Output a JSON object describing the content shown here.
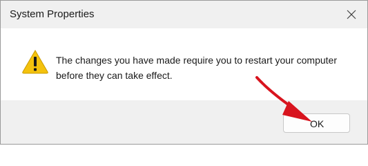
{
  "window": {
    "title": "System Properties"
  },
  "dialog": {
    "message_line1": "The changes you have made require you to restart your computer",
    "message_line2": "before they can take effect.",
    "ok_label": "OK"
  },
  "icons": {
    "close": "close-icon",
    "warning": "warning-icon",
    "annotation": "red-arrow-annotation"
  },
  "colors": {
    "warning_fill": "#f4c20d",
    "arrow": "#d8141e",
    "chrome": "#f0f0f0"
  }
}
